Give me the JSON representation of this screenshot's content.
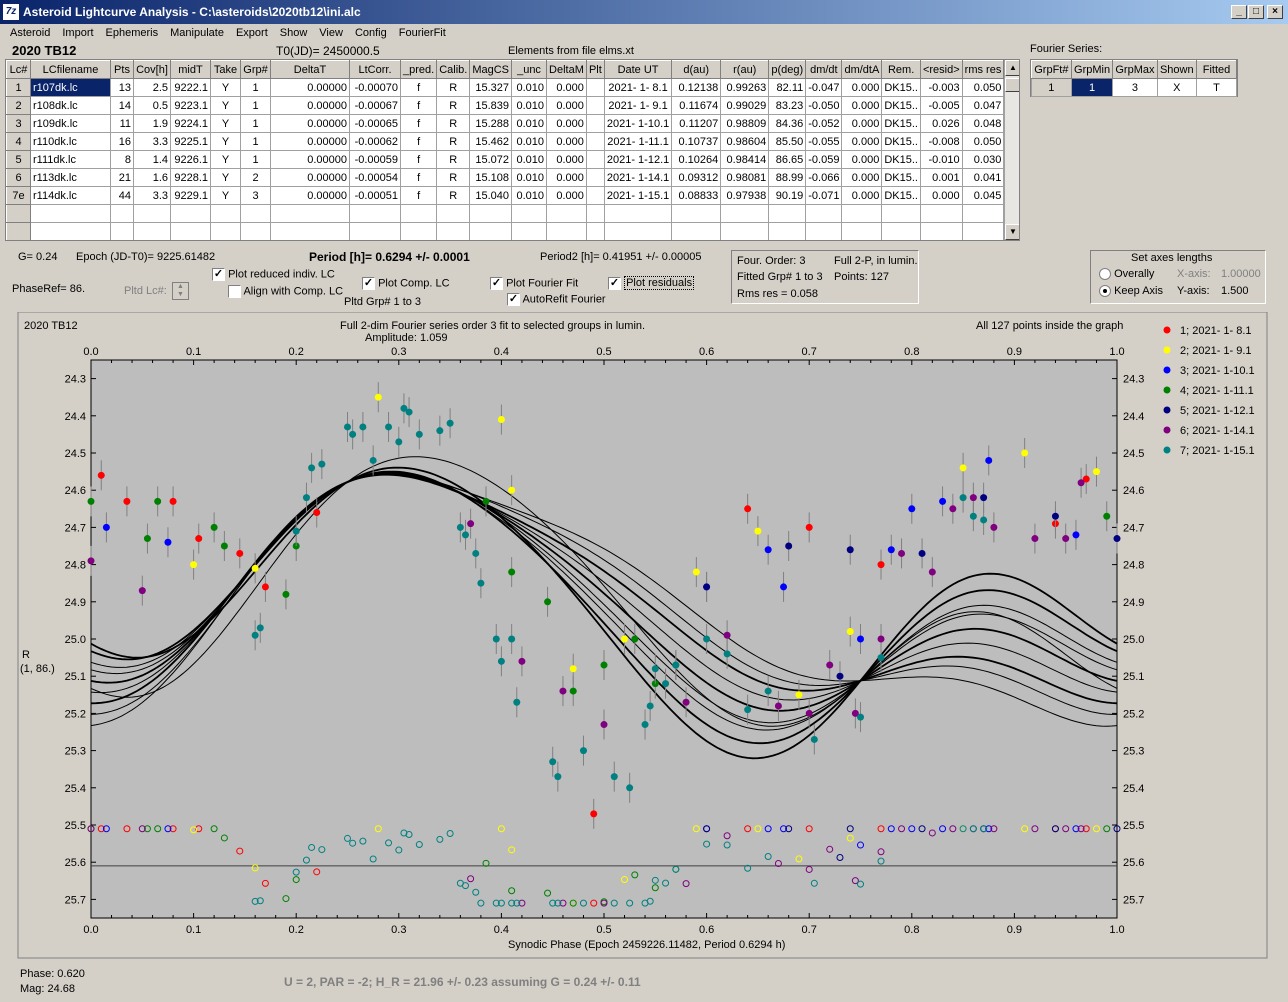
{
  "window": {
    "title": "Asteroid Lightcurve Analysis - C:\\asteroids\\2020tb12\\ini.alc"
  },
  "menu": [
    "Asteroid",
    "Import",
    "Ephemeris",
    "Manipulate",
    "Export",
    "Show",
    "View",
    "Config",
    "FourierFit"
  ],
  "header": {
    "object": "2020 TB12",
    "t0": "T0(JD)= 2450000.5",
    "elements": "Elements from file elms.xt"
  },
  "lc_table": {
    "columns": [
      "Lc#",
      "LCfilename",
      "Pts",
      "Cov[h]",
      "midT",
      "Take",
      "Grp#",
      "DeltaT",
      "LtCorr.",
      "_pred.",
      "Calib.",
      "MagCS",
      "_unc",
      "DeltaM",
      "Plt",
      "Date UT",
      "d(au)",
      "r(au)",
      "p(deg)",
      "dm/dt",
      "dm/dtA",
      "Rem.",
      "<resid>",
      "rms res"
    ],
    "rows": [
      [
        "1",
        "r107dk.lc",
        "13",
        "2.5",
        "9222.1",
        "Y",
        "1",
        "0.00000",
        "-0.00070",
        "f",
        "R",
        "15.327",
        "0.010",
        "0.000",
        "",
        "2021- 1- 8.1",
        "0.12138",
        "0.99263",
        "82.11",
        "-0.047",
        "0.000",
        "DK15..",
        "-0.003",
        "0.050"
      ],
      [
        "2",
        "r108dk.lc",
        "14",
        "0.5",
        "9223.1",
        "Y",
        "1",
        "0.00000",
        "-0.00067",
        "f",
        "R",
        "15.839",
        "0.010",
        "0.000",
        "",
        "2021- 1- 9.1",
        "0.11674",
        "0.99029",
        "83.23",
        "-0.050",
        "0.000",
        "DK15..",
        "-0.005",
        "0.047"
      ],
      [
        "3",
        "r109dk.lc",
        "11",
        "1.9",
        "9224.1",
        "Y",
        "1",
        "0.00000",
        "-0.00065",
        "f",
        "R",
        "15.288",
        "0.010",
        "0.000",
        "",
        "2021- 1-10.1",
        "0.11207",
        "0.98809",
        "84.36",
        "-0.052",
        "0.000",
        "DK15..",
        "0.026",
        "0.048"
      ],
      [
        "4",
        "r110dk.lc",
        "16",
        "3.3",
        "9225.1",
        "Y",
        "1",
        "0.00000",
        "-0.00062",
        "f",
        "R",
        "15.462",
        "0.010",
        "0.000",
        "",
        "2021- 1-11.1",
        "0.10737",
        "0.98604",
        "85.50",
        "-0.055",
        "0.000",
        "DK15..",
        "-0.008",
        "0.050"
      ],
      [
        "5",
        "r111dk.lc",
        "8",
        "1.4",
        "9226.1",
        "Y",
        "1",
        "0.00000",
        "-0.00059",
        "f",
        "R",
        "15.072",
        "0.010",
        "0.000",
        "",
        "2021- 1-12.1",
        "0.10264",
        "0.98414",
        "86.65",
        "-0.059",
        "0.000",
        "DK15..",
        "-0.010",
        "0.030"
      ],
      [
        "6",
        "r113dk.lc",
        "21",
        "1.6",
        "9228.1",
        "Y",
        "2",
        "0.00000",
        "-0.00054",
        "f",
        "R",
        "15.108",
        "0.010",
        "0.000",
        "",
        "2021- 1-14.1",
        "0.09312",
        "0.98081",
        "88.99",
        "-0.066",
        "0.000",
        "DK15..",
        "0.001",
        "0.041"
      ],
      [
        "7e",
        "r114dk.lc",
        "44",
        "3.3",
        "9229.1",
        "Y",
        "3",
        "0.00000",
        "-0.00051",
        "f",
        "R",
        "15.040",
        "0.010",
        "0.000",
        "",
        "2021- 1-15.1",
        "0.08833",
        "0.97938",
        "90.19",
        "-0.071",
        "0.000",
        "DK15..",
        "0.000",
        "0.045"
      ]
    ]
  },
  "fourier_series": {
    "label": "Fourier Series:",
    "columns": [
      "GrpFt#",
      "GrpMin",
      "GrpMax",
      "Shown",
      "Fitted"
    ],
    "row": [
      "1",
      "1",
      "3",
      "X",
      "T"
    ]
  },
  "controls": {
    "g": "G= 0.24",
    "epoch": "Epoch (JD-T0)= 9225.61482",
    "period": "Period [h]= 0.6294 +/- 0.0001",
    "period2": "Period2 [h]= 0.41951 +/- 0.00005",
    "phaseref": "PhaseRef= 86.",
    "pltd_lc": "Pltd Lc#:",
    "plot_reduced": "Plot reduced indiv. LC",
    "align_comp": "Align with Comp. LC",
    "plot_comp": "Plot Comp. LC",
    "pltd_grp": "Pltd Grp#  1   to   3",
    "plot_fourier": "Plot Fourier Fit",
    "autorefit": "AutoRefit Fourier",
    "plot_residuals": "Plot residuals"
  },
  "fourier_info": {
    "order": "Four. Order:  3",
    "full2p": "Full 2-P, in lumin.",
    "fitted": "Fitted Grp# 1 to 3",
    "points": "Points: 127",
    "rms": "Rms res      = 0.058"
  },
  "axes_panel": {
    "title": "Set axes lengths",
    "overally": "Overally",
    "keep": "Keep Axis",
    "xaxis_label": "X-axis:",
    "xaxis_val": "1.00000",
    "yaxis_label": "Y-axis:",
    "yaxis_val": "1.500"
  },
  "chart_data": {
    "type": "scatter",
    "title_left": "2020 TB12",
    "title": "Full 2-dim Fourier series order 3 fit to selected groups in lumin.",
    "amplitude": "Amplitude: 1.059",
    "note_right": "All 127 points inside the graph",
    "ylabel": "R",
    "ylabel2": "(1, 86.)",
    "xlabel": "Synodic Phase (Epoch 2459226.11482, Period 0.6294 h)",
    "xlim": [
      0,
      1
    ],
    "ylim": [
      24.25,
      25.75
    ],
    "y_inverted": true,
    "x_ticks": [
      "0.0",
      "0.1",
      "0.2",
      "0.3",
      "0.4",
      "0.5",
      "0.6",
      "0.7",
      "0.8",
      "0.9",
      "1.0"
    ],
    "y_ticks": [
      "24.3",
      "24.4",
      "24.5",
      "24.6",
      "24.7",
      "24.8",
      "24.9",
      "25.0",
      "25.1",
      "25.2",
      "25.3",
      "25.4",
      "25.5",
      "25.6",
      "25.7"
    ],
    "residual_baseline": 25.61,
    "legend_position": "right",
    "series": [
      {
        "name": "1; 2021- 1- 8.1",
        "color": "#ff0000",
        "points": [
          [
            0.01,
            24.56
          ],
          [
            0.035,
            24.63
          ],
          [
            0.08,
            24.63
          ],
          [
            0.105,
            24.73
          ],
          [
            0.145,
            24.77
          ],
          [
            0.17,
            24.86
          ],
          [
            0.22,
            24.66
          ],
          [
            0.49,
            25.47
          ],
          [
            0.64,
            24.65
          ],
          [
            0.7,
            24.7
          ],
          [
            0.77,
            24.8
          ],
          [
            0.97,
            24.57
          ],
          [
            0.94,
            24.69
          ]
        ]
      },
      {
        "name": "2; 2021- 1- 9.1",
        "color": "#ffff00",
        "points": [
          [
            0.1,
            24.8
          ],
          [
            0.16,
            24.81
          ],
          [
            0.28,
            24.35
          ],
          [
            0.4,
            24.41
          ],
          [
            0.41,
            24.6
          ],
          [
            0.47,
            25.08
          ],
          [
            0.52,
            25.0
          ],
          [
            0.59,
            24.82
          ],
          [
            0.65,
            24.71
          ],
          [
            0.74,
            24.98
          ],
          [
            0.85,
            24.54
          ],
          [
            0.91,
            24.5
          ],
          [
            0.98,
            24.55
          ],
          [
            0.69,
            25.15
          ]
        ]
      },
      {
        "name": "3; 2021- 1-10.1",
        "color": "#0000ff",
        "points": [
          [
            0.015,
            24.7
          ],
          [
            0.075,
            24.74
          ],
          [
            0.6,
            24.86
          ],
          [
            0.66,
            24.76
          ],
          [
            0.675,
            24.86
          ],
          [
            0.75,
            25.0
          ],
          [
            0.8,
            24.65
          ],
          [
            0.83,
            24.63
          ],
          [
            0.875,
            24.52
          ],
          [
            0.96,
            24.72
          ],
          [
            0.78,
            24.76
          ]
        ]
      },
      {
        "name": "4; 2021- 1-11.1",
        "color": "#008000",
        "points": [
          [
            0.0,
            24.63
          ],
          [
            0.055,
            24.73
          ],
          [
            0.065,
            24.63
          ],
          [
            0.12,
            24.7
          ],
          [
            0.13,
            24.75
          ],
          [
            0.19,
            24.88
          ],
          [
            0.2,
            24.75
          ],
          [
            0.385,
            24.63
          ],
          [
            0.41,
            24.82
          ],
          [
            0.445,
            24.9
          ],
          [
            0.47,
            25.14
          ],
          [
            0.5,
            25.07
          ],
          [
            0.53,
            25.0
          ],
          [
            0.57,
            25.07
          ],
          [
            0.99,
            24.67
          ],
          [
            0.55,
            25.12
          ]
        ]
      },
      {
        "name": "5; 2021- 1-12.1",
        "color": "#000080",
        "points": [
          [
            0.6,
            24.86
          ],
          [
            0.68,
            24.75
          ],
          [
            0.73,
            25.1
          ],
          [
            0.74,
            24.76
          ],
          [
            0.81,
            24.77
          ],
          [
            0.87,
            24.62
          ],
          [
            0.94,
            24.67
          ],
          [
            1.0,
            24.73
          ]
        ]
      },
      {
        "name": "6; 2021- 1-14.1",
        "color": "#800080",
        "points": [
          [
            0.0,
            24.79
          ],
          [
            0.05,
            24.87
          ],
          [
            0.37,
            24.69
          ],
          [
            0.42,
            25.06
          ],
          [
            0.46,
            25.14
          ],
          [
            0.5,
            25.23
          ],
          [
            0.58,
            25.17
          ],
          [
            0.62,
            24.99
          ],
          [
            0.67,
            25.18
          ],
          [
            0.7,
            25.2
          ],
          [
            0.72,
            25.07
          ],
          [
            0.745,
            25.2
          ],
          [
            0.77,
            25.0
          ],
          [
            0.79,
            24.77
          ],
          [
            0.82,
            24.82
          ],
          [
            0.84,
            24.65
          ],
          [
            0.86,
            24.62
          ],
          [
            0.88,
            24.7
          ],
          [
            0.92,
            24.73
          ],
          [
            0.95,
            24.73
          ],
          [
            0.965,
            24.58
          ]
        ]
      },
      {
        "name": "7; 2021- 1-15.1",
        "color": "#008080",
        "points": [
          [
            0.16,
            24.99
          ],
          [
            0.165,
            24.97
          ],
          [
            0.2,
            24.71
          ],
          [
            0.21,
            24.62
          ],
          [
            0.215,
            24.54
          ],
          [
            0.225,
            24.53
          ],
          [
            0.25,
            24.43
          ],
          [
            0.255,
            24.45
          ],
          [
            0.265,
            24.43
          ],
          [
            0.275,
            24.52
          ],
          [
            0.29,
            24.43
          ],
          [
            0.3,
            24.47
          ],
          [
            0.305,
            24.38
          ],
          [
            0.31,
            24.39
          ],
          [
            0.32,
            24.45
          ],
          [
            0.34,
            24.44
          ],
          [
            0.35,
            24.42
          ],
          [
            0.36,
            24.7
          ],
          [
            0.365,
            24.72
          ],
          [
            0.375,
            24.77
          ],
          [
            0.38,
            24.85
          ],
          [
            0.395,
            25.0
          ],
          [
            0.4,
            25.06
          ],
          [
            0.41,
            25.0
          ],
          [
            0.415,
            25.17
          ],
          [
            0.45,
            25.33
          ],
          [
            0.455,
            25.37
          ],
          [
            0.48,
            25.3
          ],
          [
            0.51,
            25.37
          ],
          [
            0.525,
            25.4
          ],
          [
            0.54,
            25.23
          ],
          [
            0.545,
            25.18
          ],
          [
            0.55,
            25.08
          ],
          [
            0.56,
            25.12
          ],
          [
            0.57,
            25.07
          ],
          [
            0.6,
            25.0
          ],
          [
            0.62,
            25.04
          ],
          [
            0.64,
            25.19
          ],
          [
            0.66,
            25.14
          ],
          [
            0.705,
            25.27
          ],
          [
            0.75,
            25.21
          ],
          [
            0.77,
            25.05
          ],
          [
            0.85,
            24.62
          ],
          [
            0.86,
            24.67
          ],
          [
            0.87,
            24.68
          ]
        ]
      }
    ]
  },
  "status": {
    "phase": "Phase:  0.620",
    "mag": "Mag:    24.68",
    "bottom": "U = 2, PAR = -2; H_R = 21.96 +/- 0.23 assuming G = 0.24 +/- 0.11"
  }
}
